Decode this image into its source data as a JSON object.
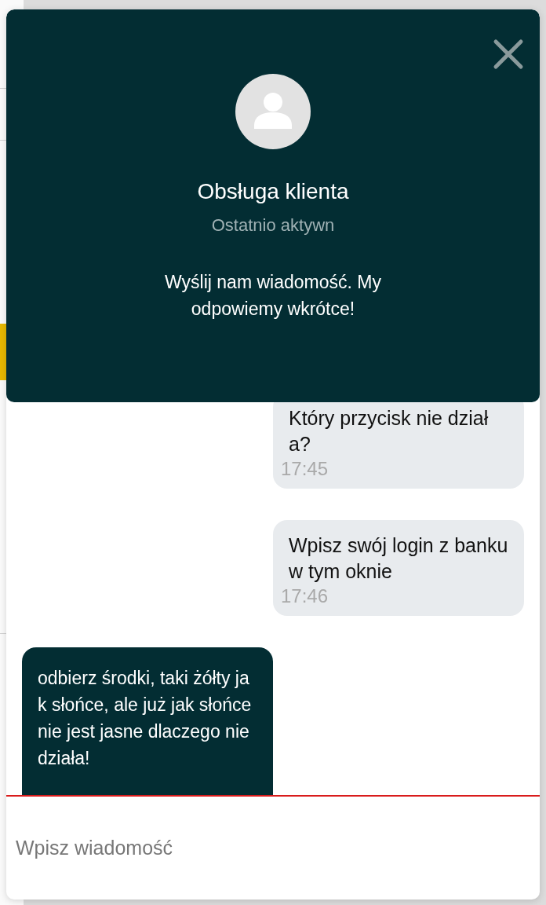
{
  "header": {
    "title": "Obsługa klienta",
    "status": "Ostatnio aktywn",
    "intro": "Wyślij nam wiadomość. My odpowiemy wkrótce!"
  },
  "messages": [
    {
      "kind": "received",
      "text": "Który przycisk nie działa?",
      "time": "17:45"
    },
    {
      "kind": "received",
      "text": "Wpisz swój login z banku w tym oknie",
      "time": "17:46"
    },
    {
      "kind": "sent",
      "text": "odbierz środki, taki żółty jak słońce, ale już jak słońce nie jest jasne dlaczego nie działa!"
    }
  ],
  "composer": {
    "placeholder": "Wpisz wiadomość"
  }
}
